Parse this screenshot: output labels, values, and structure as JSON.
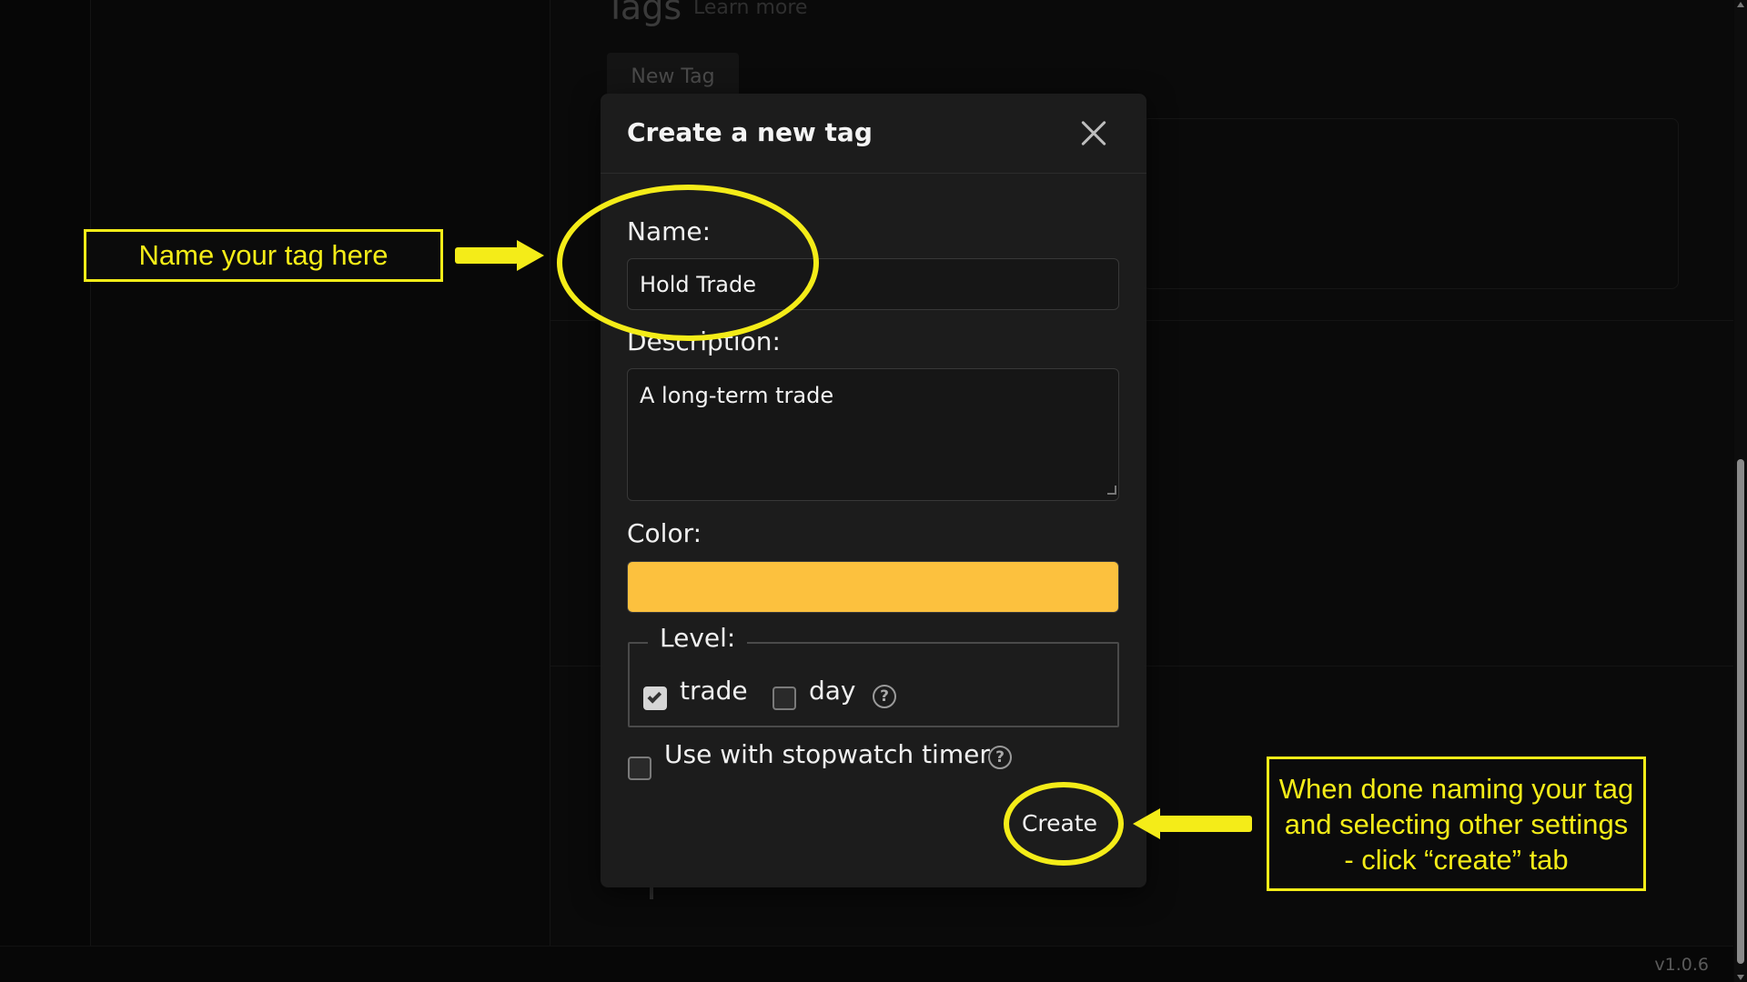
{
  "background": {
    "page_heading": "Tags",
    "learn_more": "Learn more",
    "new_tag_button": "New Tag",
    "version": "v1.0.6"
  },
  "modal": {
    "title": "Create a new tag",
    "name_label": "Name:",
    "name_value": "Hold Trade",
    "description_label": "Description:",
    "description_value": "A long-term trade",
    "color_label": "Color:",
    "color_value": "#fcc13e",
    "level_label": "Level:",
    "level_options": [
      {
        "label": "trade",
        "checked": true
      },
      {
        "label": "day",
        "checked": false
      }
    ],
    "stopwatch_label": "Use with stopwatch timer",
    "stopwatch_checked": false,
    "help_glyph": "?",
    "create_button": "Create"
  },
  "annotations": {
    "left_callout": "Name your tag here",
    "right_callout": "When done naming your tag and selecting other settings - click “create” tab",
    "highlight_color": "#f4ec18"
  }
}
